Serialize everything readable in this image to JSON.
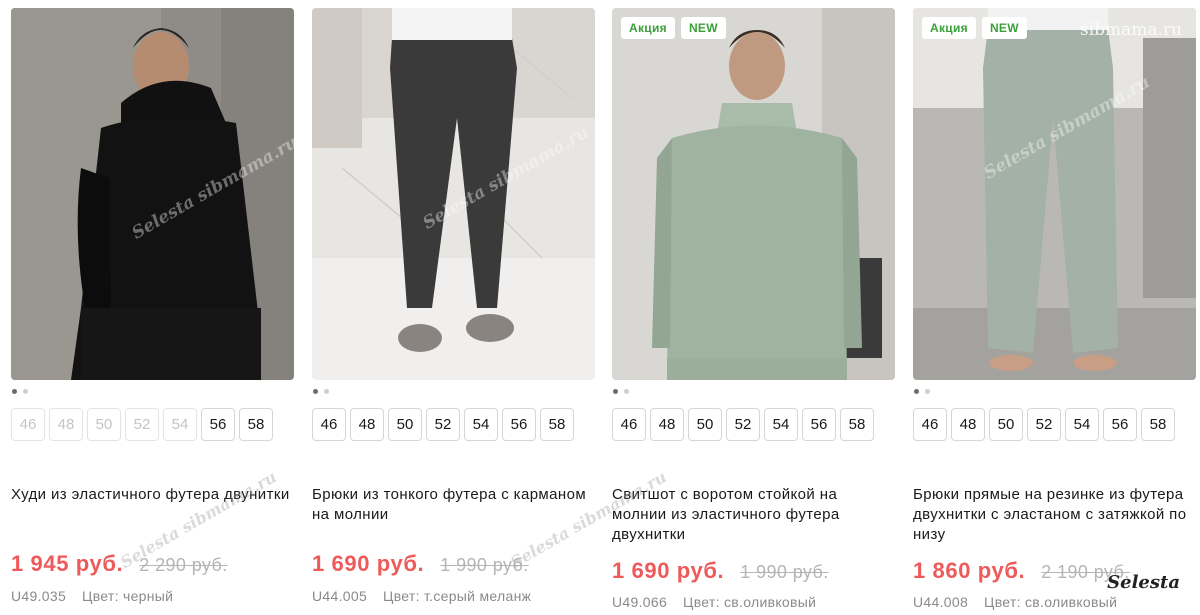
{
  "products": [
    {
      "badges": [],
      "sizes": [
        {
          "label": "46",
          "available": false
        },
        {
          "label": "48",
          "available": false
        },
        {
          "label": "50",
          "available": false
        },
        {
          "label": "52",
          "available": false
        },
        {
          "label": "54",
          "available": false
        },
        {
          "label": "56",
          "available": true
        },
        {
          "label": "58",
          "available": true
        }
      ],
      "title": "Худи из эластичного футера двунитки",
      "price": "1 945 руб.",
      "old_price": "2 290 руб.",
      "article": "U49.035",
      "color": "Цвет: черный"
    },
    {
      "badges": [],
      "sizes": [
        {
          "label": "46",
          "available": true
        },
        {
          "label": "48",
          "available": true
        },
        {
          "label": "50",
          "available": true
        },
        {
          "label": "52",
          "available": true
        },
        {
          "label": "54",
          "available": true
        },
        {
          "label": "56",
          "available": true
        },
        {
          "label": "58",
          "available": true
        }
      ],
      "title": "Брюки из тонкого футера с карманом на молнии",
      "price": "1 690 руб.",
      "old_price": "1 990 руб.",
      "article": "U44.005",
      "color": "Цвет: т.серый меланж"
    },
    {
      "badges": [
        "Акция",
        "NEW"
      ],
      "sizes": [
        {
          "label": "46",
          "available": true
        },
        {
          "label": "48",
          "available": true
        },
        {
          "label": "50",
          "available": true
        },
        {
          "label": "52",
          "available": true
        },
        {
          "label": "54",
          "available": true
        },
        {
          "label": "56",
          "available": true
        },
        {
          "label": "58",
          "available": true
        }
      ],
      "title": "Свитшот с воротом стойкой на молнии из эластичного футера двухнитки",
      "price": "1 690 руб.",
      "old_price": "1 990 руб.",
      "article": "U49.066",
      "color": "Цвет: св.оливковый"
    },
    {
      "badges": [
        "Акция",
        "NEW"
      ],
      "sizes": [
        {
          "label": "46",
          "available": true
        },
        {
          "label": "48",
          "available": true
        },
        {
          "label": "50",
          "available": true
        },
        {
          "label": "52",
          "available": true
        },
        {
          "label": "54",
          "available": true
        },
        {
          "label": "56",
          "available": true
        },
        {
          "label": "58",
          "available": true
        }
      ],
      "title": "Брюки прямые на резинке из футера двухнитки с эластаном с затяжкой по низу",
      "price": "1 860 руб.",
      "old_price": "2 190 руб.",
      "article": "U44.008",
      "color": "Цвет: св.оливковый"
    }
  ],
  "watermarks": {
    "site": "sibmama.ru",
    "photo": "Selesta sibmama.ru",
    "corner": "Selesta"
  },
  "colors": {
    "badge_text": "#3aa03a",
    "price": "#ee5a5a",
    "old_price": "#b5b5b5"
  }
}
